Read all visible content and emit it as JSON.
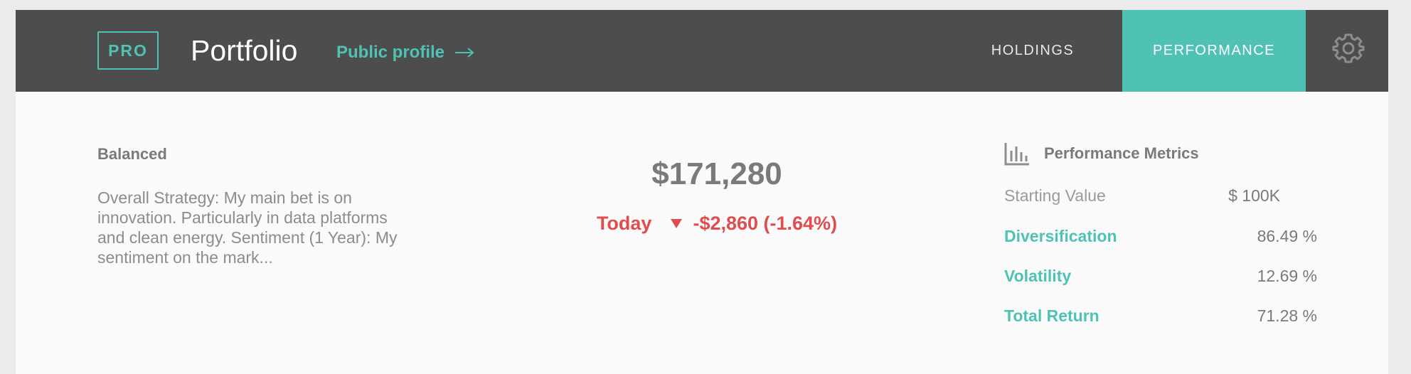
{
  "header": {
    "badge": "PRO",
    "title": "Portfolio",
    "public_profile_link": "Public profile",
    "tabs": [
      {
        "label": "HOLDINGS",
        "active": false
      },
      {
        "label": "PERFORMANCE",
        "active": true
      }
    ],
    "settings_icon": "gear-icon"
  },
  "strategy": {
    "name": "Balanced",
    "description": "Overall Strategy: My main bet is on innovation. Particularly in data platforms and clean energy. Sentiment (1 Year): My sentiment on the mark..."
  },
  "summary": {
    "total_value": "$171,280",
    "today_label": "Today",
    "change_text": "-$2,860 (-1.64%)",
    "change_icon": "triangle-down-icon"
  },
  "metrics": {
    "title": "Performance Metrics",
    "icon": "bar-chart-icon",
    "rows": [
      {
        "label": "Starting Value",
        "value": "$ 100K"
      },
      {
        "label": "Diversification",
        "value": "86.49 %"
      },
      {
        "label": "Volatility",
        "value": "12.69 %"
      },
      {
        "label": "Total Return",
        "value": "71.28 %"
      }
    ]
  },
  "colors": {
    "accent": "#4fc1b5",
    "header_bg": "#4d4d4d",
    "negative": "#e04d4f",
    "text_gray": "#7a7a7a"
  }
}
